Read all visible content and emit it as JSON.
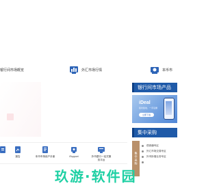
{
  "nav": {
    "items": [
      {
        "label": "银行间市场概览",
        "icon": "bank-building-icon"
      },
      {
        "label": "外汇市场行情",
        "icon": "fx-chart-icon"
      },
      {
        "label": "本币市",
        "icon": "currency-building-icon"
      }
    ]
  },
  "services": [
    {
      "label": "",
      "icon": "document-icon"
    },
    {
      "label": "报告",
      "icon": "report-icon"
    },
    {
      "label": "本币市场用户手册",
      "icon": "manual-icon"
    },
    {
      "label": "iSupport",
      "icon": "support-icon"
    },
    {
      "label": "外币银行一站式服\n务平台",
      "icon": "service-platform-icon"
    }
  ],
  "sidebar": {
    "market_header": "银行间市场产品",
    "idea": {
      "title": "iDeal",
      "subtitle": "随时随地，一手掌握",
      "button": "立即下载"
    },
    "collective_header": "集中采购",
    "collective_tab": "集中采购",
    "collective_items": [
      "债券通专区",
      "外汇市场交易专区",
      "外币拆借业务专区",
      ""
    ]
  },
  "watermark": {
    "text": "玖游·软件园"
  },
  "colors": {
    "brand_blue": "#1f5aa8",
    "accent_green": "#1fd0a4",
    "tab_brown": "#b9906a"
  }
}
